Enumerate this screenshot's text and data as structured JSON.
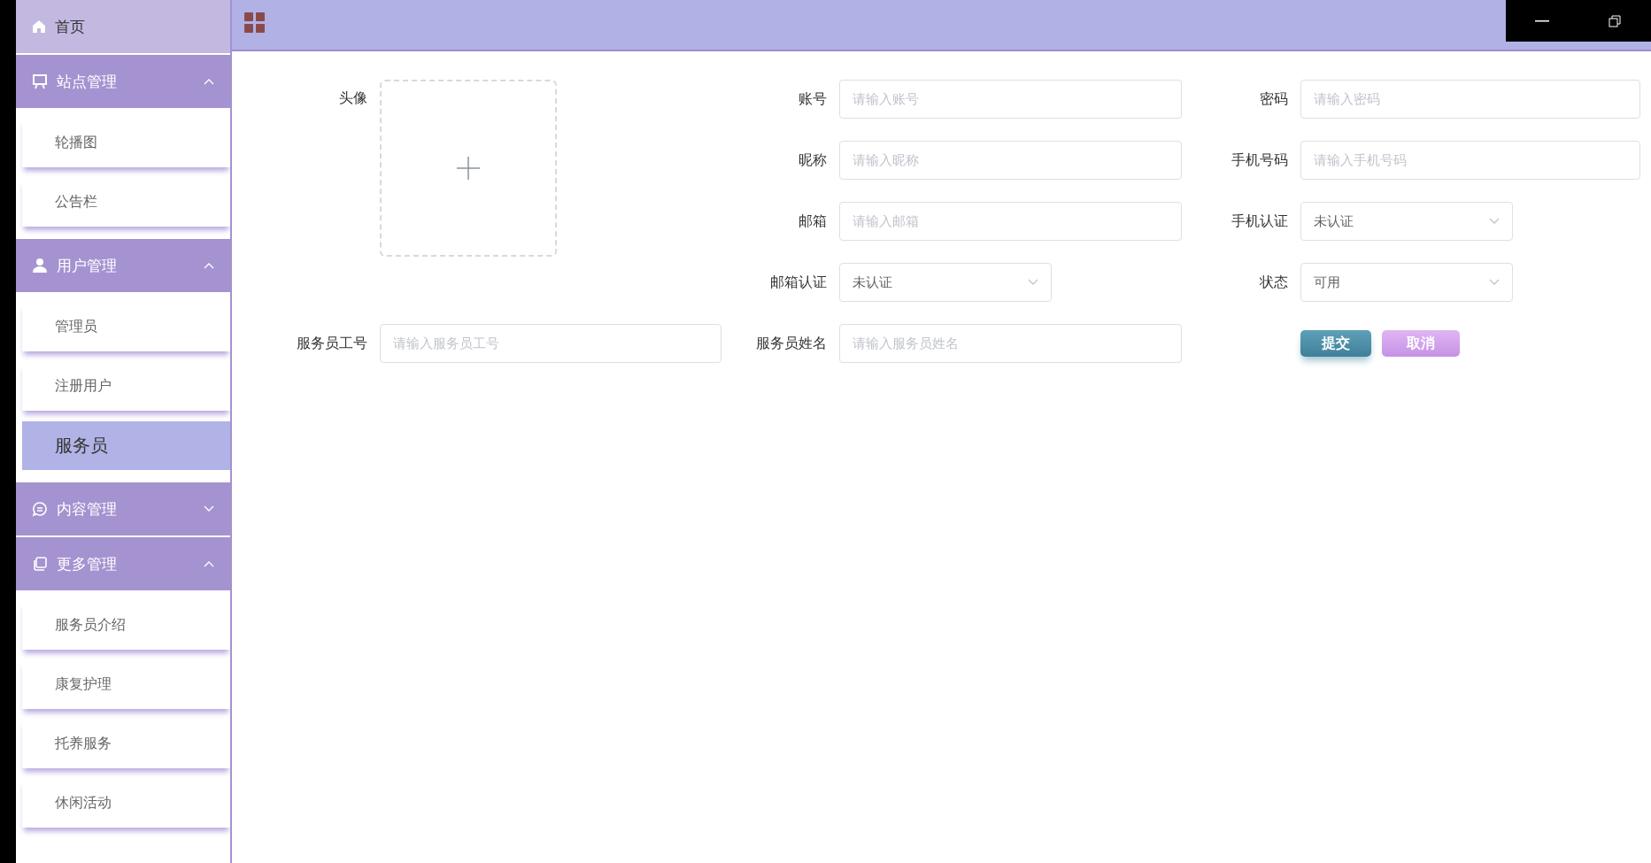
{
  "sidebar": {
    "home": {
      "label": "首页"
    },
    "groups": [
      {
        "label": "站点管理",
        "expanded": true,
        "items": [
          {
            "label": "轮播图",
            "selected": false
          },
          {
            "label": "公告栏",
            "selected": false
          }
        ]
      },
      {
        "label": "用户管理",
        "expanded": true,
        "items": [
          {
            "label": "管理员",
            "selected": false
          },
          {
            "label": "注册用户",
            "selected": false
          },
          {
            "label": "服务员",
            "selected": true
          }
        ]
      },
      {
        "label": "内容管理",
        "expanded": false
      },
      {
        "label": "更多管理",
        "expanded": true,
        "items": [
          {
            "label": "服务员介绍",
            "selected": false
          },
          {
            "label": "康复护理",
            "selected": false
          },
          {
            "label": "托养服务",
            "selected": false
          },
          {
            "label": "休闲活动",
            "selected": false
          }
        ]
      }
    ]
  },
  "form": {
    "fields": [
      {
        "label": "头像",
        "kind": "upload"
      },
      {
        "label": "账号",
        "kind": "text",
        "placeholder": "请输入账号"
      },
      {
        "label": "密码",
        "kind": "text",
        "placeholder": "请输入密码"
      },
      {
        "label": "昵称",
        "kind": "text",
        "placeholder": "请输入昵称"
      },
      {
        "label": "手机号码",
        "kind": "text",
        "placeholder": "请输入手机号码"
      },
      {
        "label": "邮箱",
        "kind": "text",
        "placeholder": "请输入邮箱"
      },
      {
        "label": "手机认证",
        "kind": "select",
        "value": "未认证"
      },
      {
        "label": "邮箱认证",
        "kind": "select",
        "value": "未认证"
      },
      {
        "label": "状态",
        "kind": "select",
        "value": "可用"
      },
      {
        "label": "服务员工号",
        "kind": "text",
        "placeholder": "请输入服务员工号"
      },
      {
        "label": "服务员姓名",
        "kind": "text",
        "placeholder": "请输入服务员姓名"
      }
    ],
    "buttons": [
      {
        "label": "提交",
        "kind": "primary"
      },
      {
        "label": "取消",
        "kind": "cancel"
      }
    ]
  }
}
